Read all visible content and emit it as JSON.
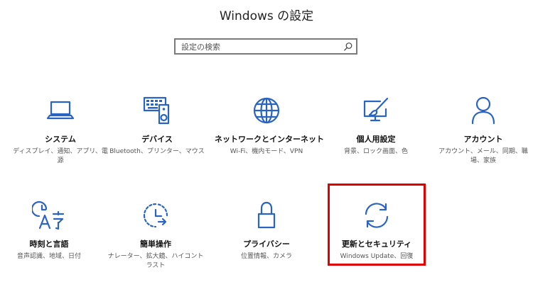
{
  "window": {
    "title": "Windows の設定"
  },
  "search": {
    "placeholder": "設定の検索"
  },
  "tiles": [
    {
      "label": "システム",
      "desc": "ディスプレイ、通知、アプリ、電源",
      "icon": "laptop-icon"
    },
    {
      "label": "デバイス",
      "desc": "Bluetooth、プリンター、マウス",
      "icon": "keyboard-speaker-icon"
    },
    {
      "label": "ネットワークとインターネット",
      "desc": "Wi-Fi、機内モード、VPN",
      "icon": "globe-icon"
    },
    {
      "label": "個人用設定",
      "desc": "背景、ロック画面、色",
      "icon": "paint-screen-icon"
    },
    {
      "label": "アカウント",
      "desc": "アカウント、メール、同期、職場、家族",
      "icon": "person-icon"
    },
    {
      "label": "時刻と言語",
      "desc": "音声認識、地域、日付",
      "icon": "clock-language-icon"
    },
    {
      "label": "簡単操作",
      "desc": "ナレーター、拡大鏡、ハイコントラスト",
      "icon": "ease-of-access-icon"
    },
    {
      "label": "プライバシー",
      "desc": "位置情報、カメラ",
      "icon": "lock-icon"
    },
    {
      "label": "更新とセキュリティ",
      "desc": "Windows Update、回復",
      "icon": "sync-arrows-icon"
    }
  ],
  "colors": {
    "accent": "#2b63c3",
    "highlight": "#e00000"
  }
}
